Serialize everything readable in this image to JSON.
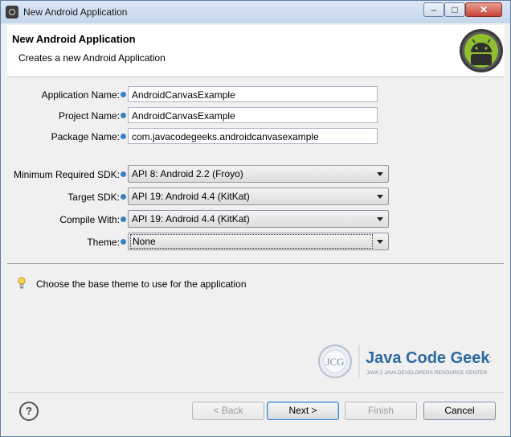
{
  "window": {
    "title": "New Android Application"
  },
  "header": {
    "title": "New Android Application",
    "subtitle": "Creates a new Android Application"
  },
  "form": {
    "app_name_label": "Application Name:",
    "app_name_value": "AndroidCanvasExample",
    "project_name_label": "Project Name:",
    "project_name_value": "AndroidCanvasExample",
    "package_name_label": "Package Name:",
    "package_name_value": "com.javacodegeeks.androidcanvasexample",
    "min_sdk_label": "Minimum Required SDK:",
    "min_sdk_value": "API 8: Android 2.2 (Froyo)",
    "target_sdk_label": "Target SDK:",
    "target_sdk_value": "API 19: Android 4.4 (KitKat)",
    "compile_with_label": "Compile With:",
    "compile_with_value": "API 19: Android 4.4 (KitKat)",
    "theme_label": "Theme:",
    "theme_value": "None"
  },
  "hint": "Choose the base theme to use for the application",
  "branding": {
    "jcg_badge": "JCG",
    "jcg_name": "Java Code Geeks",
    "jcg_tagline": "JAVA 2 JAVA DEVELOPERS RESOURCE CENTER"
  },
  "buttons": {
    "back": "< Back",
    "next": "Next >",
    "finish": "Finish",
    "cancel": "Cancel"
  },
  "colors": {
    "info_dot": "#3c7fc4",
    "android_green": "#8fbf2f",
    "default_button_border": "#3b7fc6"
  }
}
